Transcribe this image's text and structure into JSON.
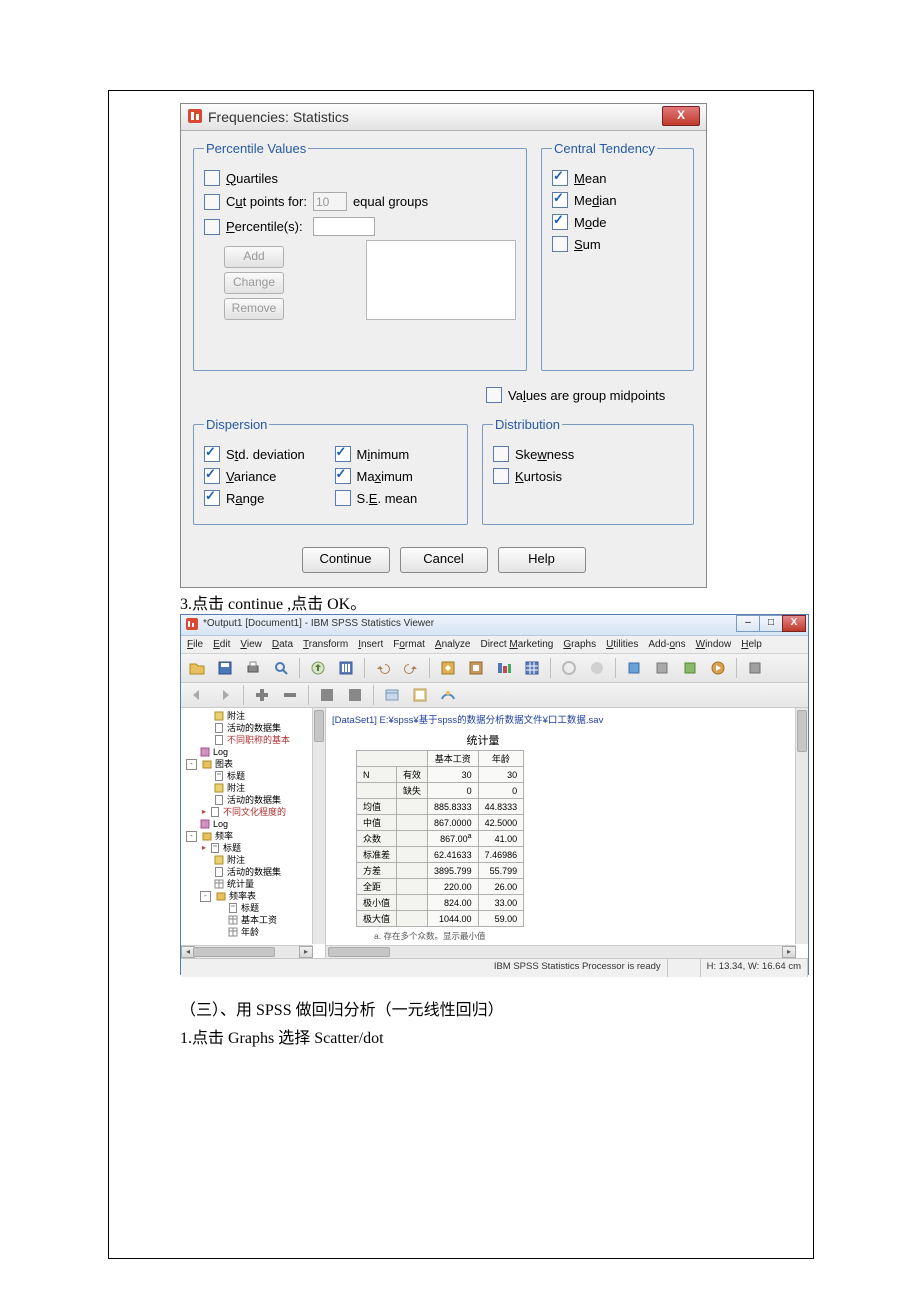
{
  "dialog1": {
    "title": "Frequencies: Statistics",
    "close": "X",
    "percentile": {
      "legend": "Percentile Values",
      "quartiles": "Quartiles",
      "cut_label_pre": "Cut points for:",
      "cut_value": "10",
      "cut_label_post": "equal groups",
      "percentiles": "Percentile(s):",
      "add": "Add",
      "change": "Change",
      "remove": "Remove"
    },
    "central": {
      "legend": "Central Tendency",
      "mean": "Mean",
      "median": "Median",
      "mode": "Mode",
      "sum": "Sum"
    },
    "midpoints": "Values are group midpoints",
    "dispersion": {
      "legend": "Dispersion",
      "std": "Std. deviation",
      "min": "Minimum",
      "var": "Variance",
      "max": "Maximum",
      "range": "Range",
      "se": "S.E. mean"
    },
    "distribution": {
      "legend": "Distribution",
      "skew": "Skewness",
      "kurt": "Kurtosis"
    },
    "buttons": {
      "continue": "Continue",
      "cancel": "Cancel",
      "help": "Help"
    }
  },
  "narrative": {
    "line1": "3.点击 continue ,点击 OK。",
    "line2": "（三）、用 SPSS 做回归分析（一元线性回归）",
    "line3": "1.点击 Graphs  选择 Scatter/dot"
  },
  "viewer": {
    "title": "*Output1 [Document1] - IBM SPSS Statistics Viewer",
    "menu": [
      "File",
      "Edit",
      "View",
      "Data",
      "Transform",
      "Insert",
      "Format",
      "Analyze",
      "Direct Marketing",
      "Graphs",
      "Utilities",
      "Add-ons",
      "Window",
      "Help"
    ],
    "dataset_path": "[DataSet1] E:¥spss¥基于spss的数据分析数据文件¥口工数据.sav",
    "tree": [
      {
        "indent": 28,
        "icon": "note",
        "label": "附注"
      },
      {
        "indent": 28,
        "icon": "doc",
        "label": "活动的数据集"
      },
      {
        "indent": 28,
        "icon": "doc",
        "label": "不同职称的基本",
        "red": true
      },
      {
        "indent": 14,
        "icon": "log",
        "label": "Log"
      },
      {
        "indent": 0,
        "toggle": "-",
        "icon": "folder",
        "label": "图表"
      },
      {
        "indent": 28,
        "icon": "title",
        "label": "标题"
      },
      {
        "indent": 28,
        "icon": "note",
        "label": "附注"
      },
      {
        "indent": 28,
        "icon": "doc",
        "label": "活动的数据集"
      },
      {
        "indent": 28,
        "icon": "doc",
        "label": "不同文化程度的",
        "red": true,
        "arrow": true
      },
      {
        "indent": 14,
        "icon": "log",
        "label": "Log"
      },
      {
        "indent": 0,
        "toggle": "-",
        "icon": "folder",
        "label": "频率"
      },
      {
        "indent": 28,
        "icon": "title",
        "label": "标题",
        "arrow": true
      },
      {
        "indent": 28,
        "icon": "note",
        "label": "附注"
      },
      {
        "indent": 28,
        "icon": "doc",
        "label": "活动的数据集"
      },
      {
        "indent": 28,
        "icon": "table",
        "label": "统计量"
      },
      {
        "indent": 14,
        "toggle": "-",
        "icon": "folder",
        "label": "频率表"
      },
      {
        "indent": 42,
        "icon": "title",
        "label": "标题"
      },
      {
        "indent": 42,
        "icon": "table",
        "label": "基本工资"
      },
      {
        "indent": 42,
        "icon": "table",
        "label": "年龄"
      }
    ],
    "stats": {
      "title": "统计量",
      "col1": "基本工资",
      "col2": "年龄",
      "rows": [
        {
          "l1": "N",
          "l2": "有效",
          "v1": "30",
          "v2": "30"
        },
        {
          "l1": "",
          "l2": "缺失",
          "v1": "0",
          "v2": "0"
        },
        {
          "l1": "均值",
          "l2": "",
          "v1": "885.8333",
          "v2": "44.8333"
        },
        {
          "l1": "中值",
          "l2": "",
          "v1": "867.0000",
          "v2": "42.5000"
        },
        {
          "l1": "众数",
          "l2": "",
          "v1": "867.00",
          "v1sup": "a",
          "v2": "41.00"
        },
        {
          "l1": "标准差",
          "l2": "",
          "v1": "62.41633",
          "v2": "7.46986"
        },
        {
          "l1": "方差",
          "l2": "",
          "v1": "3895.799",
          "v2": "55.799"
        },
        {
          "l1": "全距",
          "l2": "",
          "v1": "220.00",
          "v2": "26.00"
        },
        {
          "l1": "极小值",
          "l2": "",
          "v1": "824.00",
          "v2": "33.00"
        },
        {
          "l1": "极大值",
          "l2": "",
          "v1": "1044.00",
          "v2": "59.00"
        }
      ],
      "note": "a. 存在多个众数。显示最小值"
    },
    "status": {
      "processor": "IBM SPSS Statistics Processor is ready",
      "dims": "H: 13.34, W: 16.64 cm"
    }
  }
}
